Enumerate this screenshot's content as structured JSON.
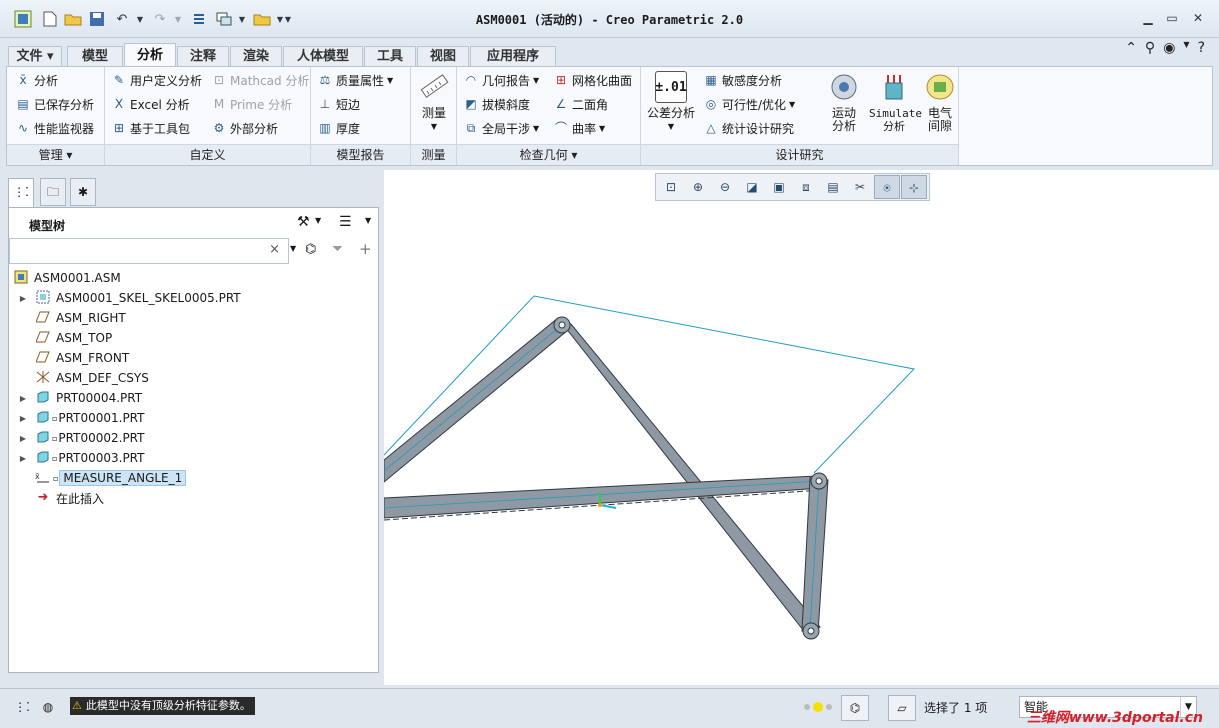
{
  "window": {
    "title": "ASM0001 (活动的) - Creo Parametric 2.0"
  },
  "ribbon_tabs": [
    "文件",
    "模型",
    "分析",
    "注释",
    "渲染",
    "人体模型",
    "工具",
    "视图",
    "应用程序"
  ],
  "active_tab": "分析",
  "groups": {
    "manage": {
      "label": "管理",
      "items": [
        "分析",
        "已保存分析",
        "性能监视器"
      ]
    },
    "custom": {
      "label": "自定义",
      "items": [
        "用户定义分析",
        "Excel 分析",
        "基于工具包",
        "Mathcad 分析",
        "Prime 分析",
        "外部分析"
      ]
    },
    "model_report": {
      "label": "模型报告",
      "items": [
        "质量属性",
        "短边",
        "厚度"
      ]
    },
    "measure": {
      "label": "测量",
      "button": "测量"
    },
    "inspect": {
      "label": "检查几何",
      "items": [
        "几何报告",
        "拔模斜度",
        "全局干涉",
        "网格化曲面",
        "二面角",
        "曲率"
      ]
    },
    "design_study": {
      "label": "设计研究",
      "tolerance": "公差分析",
      "tolerance_icon_text": "±.01",
      "items": [
        "敏感度分析",
        "可行性/优化",
        "统计设计研究"
      ],
      "motion": "运动\n分析",
      "simulate": "Simulate\n分析",
      "electric": "电气\n间隙"
    }
  },
  "panel": {
    "title": "模型树",
    "search_placeholder": "",
    "tree": [
      {
        "label": "ASM0001.ASM",
        "icon": "assembly-icon",
        "expander": false
      },
      {
        "label": "ASM0001_SKEL_SKEL0005.PRT",
        "icon": "skeleton-icon",
        "expander": true
      },
      {
        "label": "ASM_RIGHT",
        "icon": "datum-plane-icon",
        "expander": false
      },
      {
        "label": "ASM_TOP",
        "icon": "datum-plane-icon",
        "expander": false
      },
      {
        "label": "ASM_FRONT",
        "icon": "datum-plane-icon",
        "expander": false
      },
      {
        "label": "ASM_DEF_CSYS",
        "icon": "csys-icon",
        "expander": false
      },
      {
        "label": "PRT00004.PRT",
        "icon": "part-icon",
        "expander": true
      },
      {
        "label": "PRT00001.PRT",
        "icon": "part-icon",
        "expander": true
      },
      {
        "label": "PRT00002.PRT",
        "icon": "part-icon",
        "expander": true
      },
      {
        "label": "PRT00003.PRT",
        "icon": "part-icon",
        "expander": true
      },
      {
        "label": "MEASURE_ANGLE_1",
        "icon": "measure-icon",
        "expander": false
      },
      {
        "label": "在此插入",
        "icon": "insert-arrow-icon",
        "expander": false
      }
    ]
  },
  "status": {
    "message": "此模型中没有顶级分析特征参数。",
    "selection": "选择了 1 项",
    "filter_value": "智能",
    "watermark": "三维网www.3dportal.cn"
  },
  "colors": {
    "link_steel": "#8e99a3",
    "skeleton_line": "#1f9bc2"
  }
}
